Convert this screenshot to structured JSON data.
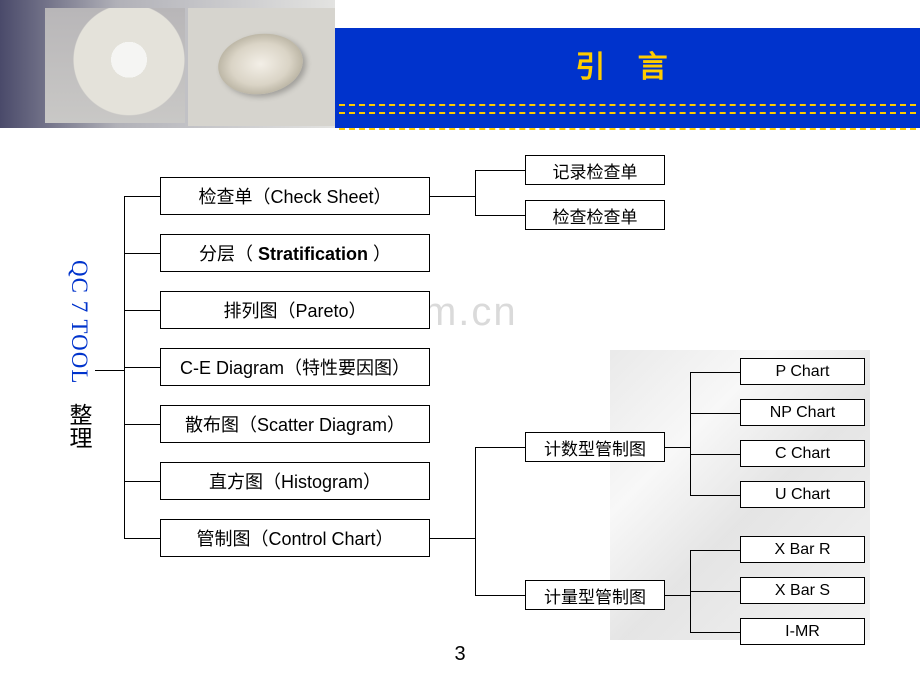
{
  "header": {
    "title": "引  言"
  },
  "root": {
    "en": "QC 7 TOOL",
    "zh": "整理"
  },
  "tools": [
    {
      "label": "检查单（Check Sheet）"
    },
    {
      "label_prefix": "分层（ ",
      "label_bold": "Stratification",
      "label_suffix": " ）"
    },
    {
      "label": "排列图（Pareto）"
    },
    {
      "label": "C-E Diagram（特性要因图）"
    },
    {
      "label": "散布图（Scatter Diagram）"
    },
    {
      "label": "直方图（Histogram）"
    },
    {
      "label": "管制图（Control Chart）"
    }
  ],
  "check_sheet_subs": [
    {
      "label": "记录检查单"
    },
    {
      "label": "检查检查单"
    }
  ],
  "control_chart_groups": [
    {
      "label": "计数型管制图"
    },
    {
      "label": "计量型管制图"
    }
  ],
  "count_charts": [
    {
      "label": "P Chart"
    },
    {
      "label": "NP Chart"
    },
    {
      "label": "C Chart"
    },
    {
      "label": "U Chart"
    }
  ],
  "var_charts": [
    {
      "label": "X Bar R"
    },
    {
      "label": "X Bar S"
    },
    {
      "label": "I-MR"
    }
  ],
  "watermark": "www.zixin.com.cn",
  "page_number": "3"
}
